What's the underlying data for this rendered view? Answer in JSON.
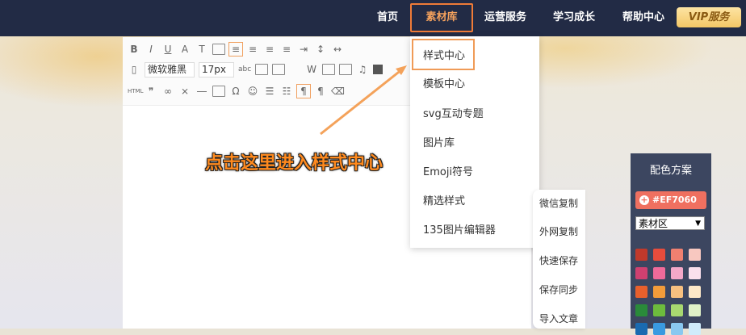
{
  "nav": {
    "items": [
      "首页",
      "素材库",
      "运营服务",
      "学习成长",
      "帮助中心"
    ],
    "vip": "VIP服务"
  },
  "toolbar": {
    "font_family": "微软雅黑",
    "font_size": "17px"
  },
  "menu": {
    "items": [
      "样式中心",
      "模板中心",
      "svg互动专题",
      "图片库",
      "Emoji符号",
      "精选样式",
      "135图片编辑器"
    ]
  },
  "annotation": "点击这里进入样式中心",
  "side_panel": {
    "items": [
      "微信复制",
      "外网复制",
      "快速保存",
      "保存同步",
      "导入文章"
    ]
  },
  "color_scheme": {
    "title": "配色方案",
    "current_color": "#EF7060",
    "select_value": "素材区",
    "swatches": [
      [
        "#c0392b",
        "#e74c3c",
        "#f08070",
        "#f8c8c0"
      ],
      [
        "#d04070",
        "#f06a9a",
        "#f4a8c8",
        "#fbe0ec"
      ],
      [
        "#e8602c",
        "#f39c3a",
        "#f7c080",
        "#fde8c8"
      ],
      [
        "#2a8a3a",
        "#6dbb3d",
        "#a8d870",
        "#e0f2c8"
      ],
      [
        "#1a6ab0",
        "#3a9ae0",
        "#8ac8f0",
        "#d0ecfb"
      ]
    ]
  },
  "colors": {
    "nav_bg": "#222b45",
    "accent": "#ef7b38"
  }
}
